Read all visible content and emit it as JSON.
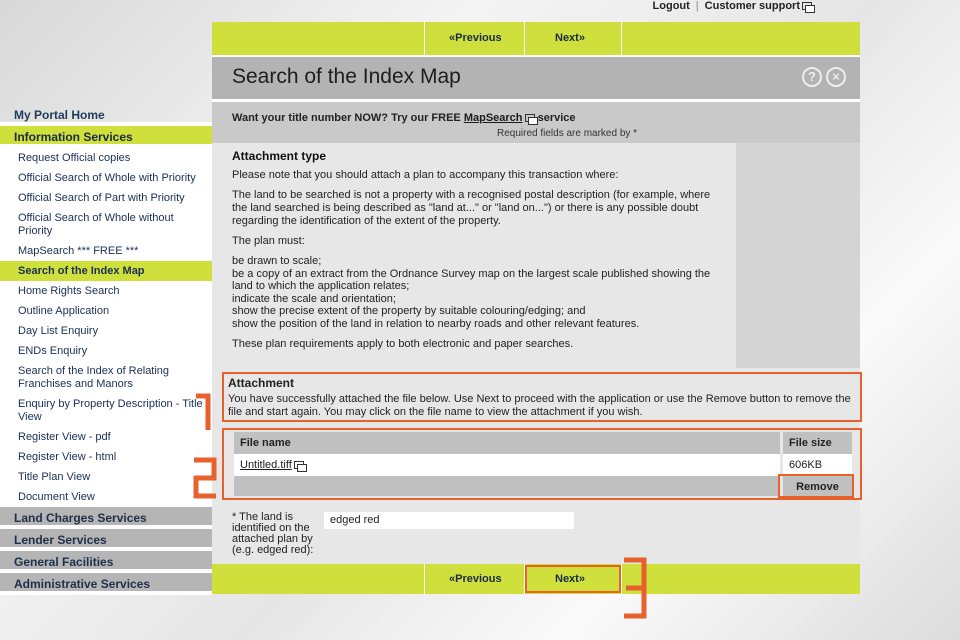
{
  "topbar": {
    "logout": "Logout",
    "support": "Customer support"
  },
  "sidebar": {
    "home": "My Portal Home",
    "info": "Information Services",
    "items": [
      "Request Official copies",
      "Official Search of Whole with Priority",
      "Official Search of Part with Priority",
      "Official Search of Whole without Priority",
      "MapSearch *** FREE ***",
      "Search of the Index Map",
      "Home Rights Search",
      "Outline Application",
      "Day List Enquiry",
      "ENDs Enquiry",
      "Search of the Index of Relating Franchises and Manors",
      "Enquiry by Property Description - Title View",
      "Register View - pdf",
      "Register View - html",
      "Title Plan View",
      "Document View"
    ],
    "land_charges": "Land Charges Services",
    "lender": "Lender Services",
    "general": "General Facilities",
    "admin": "Administrative Services"
  },
  "nav": {
    "previous": "«Previous",
    "next": "Next»"
  },
  "page_title": "Search of the Index Map",
  "promo": {
    "prefix": "Want your title number NOW? Try our FREE ",
    "link": "MapSearch",
    "suffix": " service",
    "required": "Required fields are marked by *"
  },
  "attachment_type": {
    "heading": "Attachment type",
    "p1": "Please note that you should attach a plan to accompany this transaction where:",
    "p2": "The land to be searched is not a property with a recognised postal description (for example, where the land searched is being described as \"land at...\" or \"land on...\") or there is any possible doubt regarding the identification of the extent of the property.",
    "p3": "The plan must:",
    "reqs": [
      "be drawn to scale;",
      "be a copy of an extract from the Ordnance Survey map on the largest scale published showing the land to which the application relates;",
      "indicate the scale and orientation;",
      "show the precise extent of the property by suitable colouring/edging; and",
      "show the position of the land in relation to nearby roads and other relevant features."
    ],
    "p4": "These plan requirements apply to both electronic and paper searches."
  },
  "attachment": {
    "heading": "Attachment",
    "text": "You have successfully attached the file below. Use Next to proceed with the application or use the Remove button to remove the file and start again. You may click on the file name to view the attachment if you wish."
  },
  "file_table": {
    "col_name": "File name",
    "col_size": "File size",
    "file_name": "Untitled.tiff",
    "file_size": "606KB",
    "remove": "Remove"
  },
  "edged": {
    "label": "* The land is identified on the attached plan by (e.g. edged red):",
    "value": "edged red"
  },
  "markers": [
    "1",
    "2",
    "3"
  ],
  "colors": {
    "accent": "#cfe03d",
    "highlight": "#e8602c"
  }
}
